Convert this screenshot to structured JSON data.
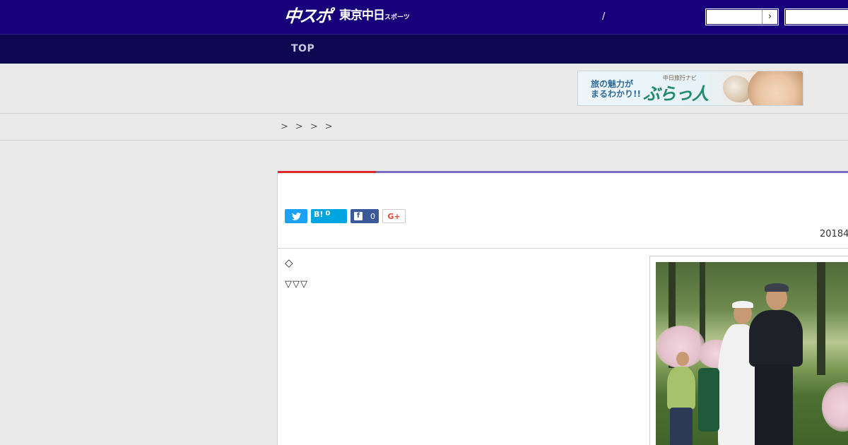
{
  "header": {
    "logo_main": "中スポ",
    "logo_sub": "東京中日",
    "logo_sub_small": "スポーツ",
    "slash": "/",
    "search_button_glyph": "›"
  },
  "nav": {
    "top_label": "TOP"
  },
  "banner": {
    "line1": "旅の魅力が",
    "line2": "まるわかり!!",
    "small": "中日旅行ナビ",
    "big": "ぶらっ人"
  },
  "breadcrumb": [
    ">",
    ">",
    ">",
    ">"
  ],
  "share": {
    "hatena_label": "B!",
    "hatena_count": "0",
    "facebook_icon": "f",
    "facebook_count": "0",
    "gplus_label": "G+"
  },
  "article": {
    "date": "20184",
    "line1": "◇",
    "line2": "▽▽▽"
  },
  "colors": {
    "header_bg": "#17007a",
    "nav_bg": "#0f0651",
    "accent_red": "#e0262d",
    "accent_purple": "#7a6cc0",
    "twitter": "#1da1f2",
    "hatena": "#00a4de",
    "facebook": "#3b5998",
    "gplus": "#dd4b39"
  },
  "icons": [
    "twitter-icon",
    "hatena-icon",
    "facebook-icon",
    "google-plus-icon",
    "chevron-right-icon"
  ]
}
